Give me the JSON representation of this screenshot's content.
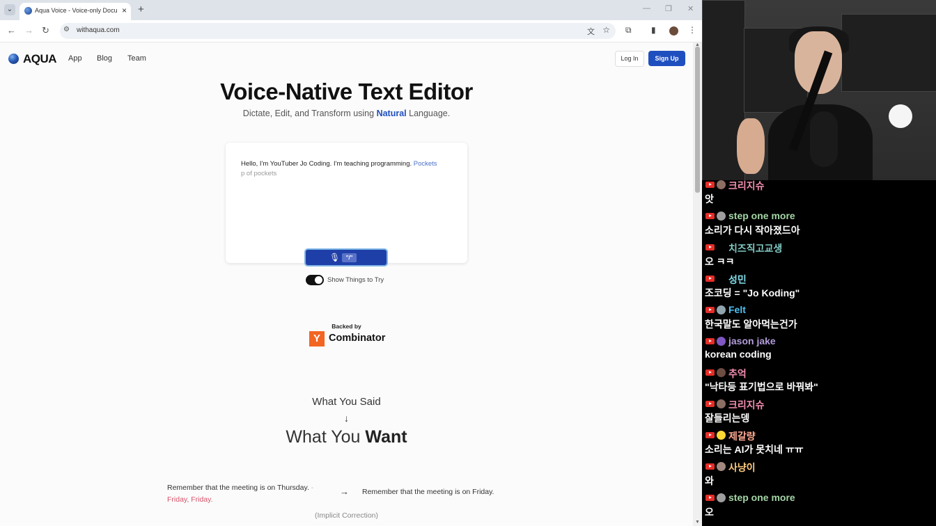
{
  "browser": {
    "tab_title": "Aqua Voice - Voice-only Docu",
    "url": "withaqua.com",
    "new_tab": "+",
    "tab_close": "×"
  },
  "site": {
    "logo_text": "AQUA",
    "nav": [
      "App",
      "Blog",
      "Team"
    ],
    "login": "Log In",
    "signup": "Sign Up",
    "title": "Voice-Native Text Editor",
    "subtitle_pre": "Dictate, Edit, and Transform using ",
    "subtitle_hl": "Natural",
    "subtitle_post": " Language.",
    "editor_text": "Hello, I'm YouTuber Jo Coding. I'm teaching programming. ",
    "editor_interim": "Pockets",
    "editor_interim2": "p of pockets",
    "shortcut_key": "\"/\"",
    "toggle_label": "Show Things to Try",
    "backed_by": "Backed by",
    "yc_letter": "Y",
    "yc_word": "Combinator",
    "said": "What You Said",
    "arrow": "↓",
    "want_pre": "What You ",
    "want_bold": "Want",
    "example_left": "Remember that the meeting is on Thursday.",
    "example_left_dash": " -",
    "example_left_red": "Friday, Friday.",
    "example_arrow": "→",
    "example_right": "Remember that the meeting is on Friday.",
    "example_caption": "(Implicit Correction)"
  },
  "chat": {
    "messages": [
      {
        "name": "크리지슈",
        "text": "앗",
        "name_color": "#f48fb1",
        "avatar_color": "#8d6e63"
      },
      {
        "name": "step one more",
        "text": "소리가 다시 작아졌드아",
        "name_color": "#a5d6a7",
        "avatar_color": "#9e9e9e"
      },
      {
        "name": "치즈직고교생",
        "text": "오 ㅋㅋ",
        "name_color": "#80cbc4",
        "avatar_color": "#000000"
      },
      {
        "name": "성민",
        "text": "조코딩 = \"Jo Koding\"",
        "name_color": "#80deea",
        "avatar_color": "#000000"
      },
      {
        "name": "Felt",
        "text": "한국말도 알아먹는건가",
        "name_color": "#4fc3f7",
        "avatar_color": "#90a4ae"
      },
      {
        "name": "jason jake",
        "text": "korean coding",
        "name_color": "#b39ddb",
        "avatar_color": "#7e57c2"
      },
      {
        "name": "추억",
        "text": "\"낙타등 표기법으로 바꿔봐\"",
        "name_color": "#f48fb1",
        "avatar_color": "#6d4c41"
      },
      {
        "name": "크리지슈",
        "text": "잘들리는뎅",
        "name_color": "#f48fb1",
        "avatar_color": "#8d6e63"
      },
      {
        "name": "제갈량",
        "text": "소리는 AI가 못치네 ㅠㅠ",
        "name_color": "#ffab91",
        "avatar_color": "#fdd835"
      },
      {
        "name": "사냥이",
        "text": "와",
        "name_color": "#ffcc80",
        "avatar_color": "#a1887f"
      },
      {
        "name": "step one more",
        "text": "오",
        "name_color": "#a5d6a7",
        "avatar_color": "#9e9e9e"
      }
    ]
  }
}
